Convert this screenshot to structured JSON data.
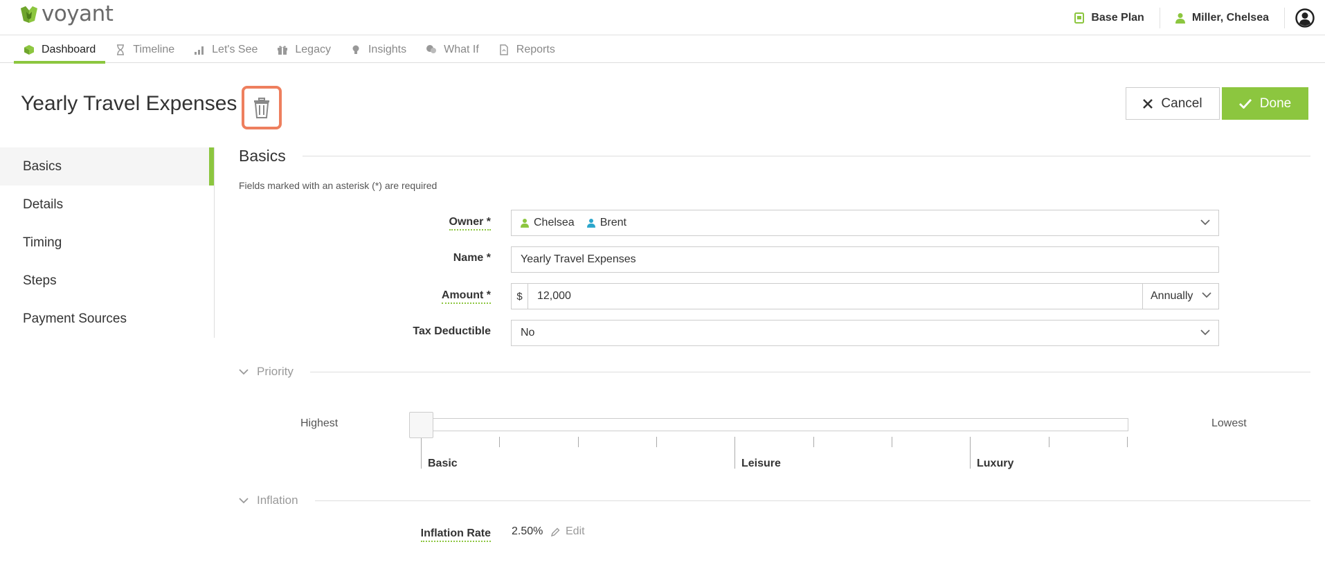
{
  "app": {
    "brand": "voyant",
    "plan_label": "Base Plan",
    "user_name": "Miller, Chelsea",
    "accent_color": "#8cc63f",
    "highlight_color": "#ee7f5e"
  },
  "nav": {
    "tabs": [
      {
        "label": "Dashboard",
        "icon": "cube-icon",
        "active": true
      },
      {
        "label": "Timeline",
        "icon": "hourglass-icon",
        "active": false
      },
      {
        "label": "Let's See",
        "icon": "bar-chart-icon",
        "active": false
      },
      {
        "label": "Legacy",
        "icon": "gift-icon",
        "active": false
      },
      {
        "label": "Insights",
        "icon": "lightbulb-icon",
        "active": false
      },
      {
        "label": "What If",
        "icon": "people-icon",
        "active": false
      },
      {
        "label": "Reports",
        "icon": "document-icon",
        "active": false
      }
    ]
  },
  "header": {
    "title": "Yearly Travel Expenses",
    "cancel_label": "Cancel",
    "done_label": "Done"
  },
  "side_menu": {
    "items": [
      {
        "label": "Basics",
        "active": true
      },
      {
        "label": "Details",
        "active": false
      },
      {
        "label": "Timing",
        "active": false
      },
      {
        "label": "Steps",
        "active": false
      },
      {
        "label": "Payment Sources",
        "active": false
      }
    ]
  },
  "basics": {
    "heading": "Basics",
    "required_note": "Fields marked with an asterisk (*) are required",
    "owner_label": "Owner *",
    "owners": [
      {
        "name": "Chelsea",
        "color": "#8cc63f"
      },
      {
        "name": "Brent",
        "color": "#2ba6cb"
      }
    ],
    "name_label": "Name *",
    "name_value": "Yearly Travel Expenses",
    "amount_label": "Amount *",
    "amount_prefix": "$",
    "amount_value": "12,000",
    "amount_frequency": "Annually",
    "tax_label": "Tax Deductible",
    "tax_value": "No"
  },
  "priority": {
    "heading": "Priority",
    "low_end": "Highest",
    "high_end": "Lowest",
    "value_fraction": 0,
    "markers": [
      "Basic",
      "Leisure",
      "Luxury"
    ]
  },
  "inflation": {
    "heading": "Inflation",
    "rate_label": "Inflation Rate",
    "rate_value": "2.50%",
    "edit_label": "Edit"
  }
}
